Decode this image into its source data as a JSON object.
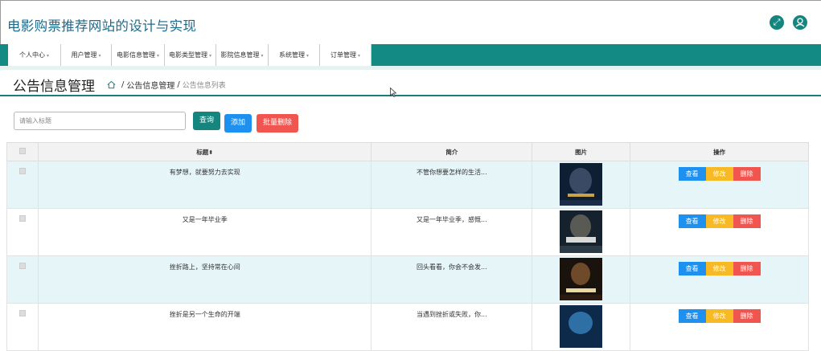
{
  "app": {
    "title": "电影购票推荐网站的设计与实现"
  },
  "header_icons": [
    "expand-icon",
    "user-icon"
  ],
  "nav": {
    "items": [
      "个人中心",
      "用户管理",
      "电影信息管理",
      "电影类型管理",
      "影院信息管理",
      "系统管理",
      "订单管理"
    ]
  },
  "page": {
    "title": "公告信息管理",
    "breadcrumb": [
      "公告信息管理",
      "公告信息列表"
    ]
  },
  "search": {
    "placeholder": "请输入标题",
    "query_label": "查询",
    "add_label": "添加",
    "batch_delete_label": "批量删除"
  },
  "table": {
    "columns": [
      "标题",
      "简介",
      "图片",
      "操作"
    ],
    "actions": [
      "查看",
      "修改",
      "删除"
    ],
    "rows": [
      {
        "title": "有梦想，就要努力去实现",
        "summary": "不管你想要怎样的生活..."
      },
      {
        "title": "又是一年毕业季",
        "summary": "又是一年毕业季，感慨..."
      },
      {
        "title": "挫折路上，坚持常在心间",
        "summary": "回头看看，你会不会发..."
      },
      {
        "title": "挫折是另一个生命的开端",
        "summary": "当遇到挫折或失败，你..."
      }
    ]
  },
  "colors": {
    "primary": "#15857f",
    "blue": "#1e90ef",
    "yellow": "#f7b924",
    "red": "#f0564f",
    "title": "#1d6a8a"
  }
}
